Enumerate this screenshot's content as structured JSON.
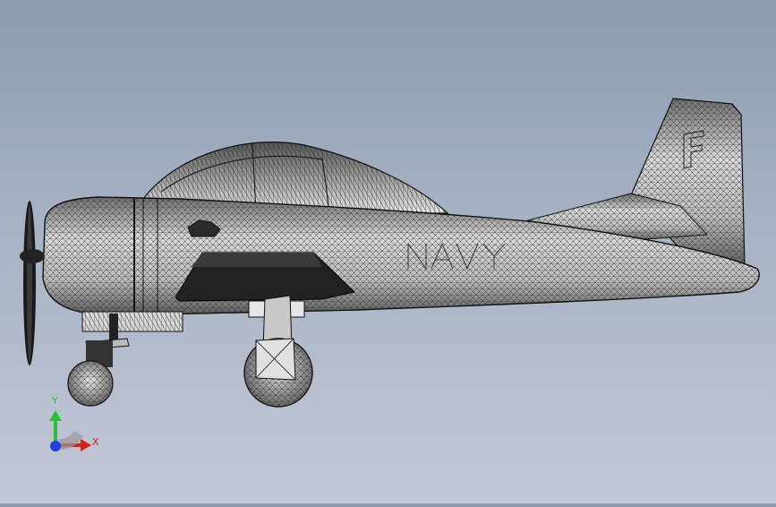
{
  "viewport": {
    "model": "airplane-wireframe",
    "fuselage_marking": "NAVY",
    "tail_marking": "F"
  },
  "triad": {
    "y_label": "Y",
    "x_label": "X",
    "colors": {
      "y": "#2dbd3c",
      "x": "#d62020",
      "z": "#2040e0"
    }
  }
}
